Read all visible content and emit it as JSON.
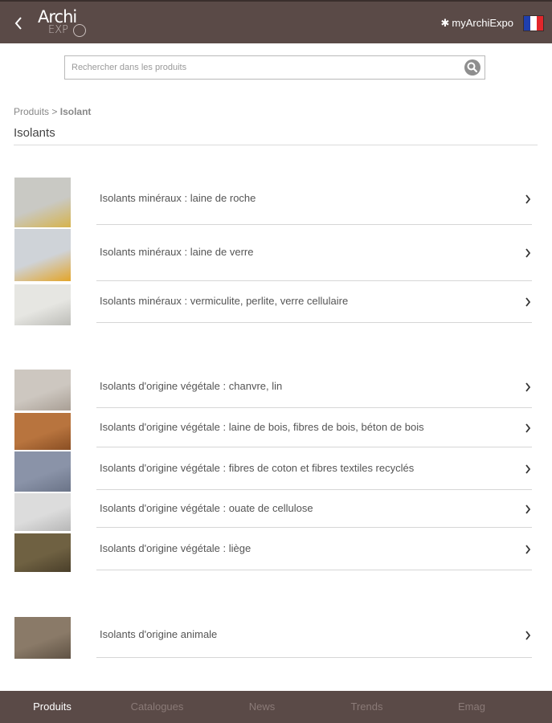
{
  "header": {
    "logo_top": "Archi",
    "logo_bottom": "EXP",
    "my_expo_label": "myArchiExpo",
    "flag_colors": [
      "#1f3fae",
      "#ffffff",
      "#e1262b"
    ]
  },
  "search": {
    "placeholder": "Rechercher dans les produits",
    "value": ""
  },
  "breadcrumb": {
    "root": "Produits",
    "separator": ">",
    "current": "Isolant"
  },
  "page_title": "Isolants",
  "groups": [
    {
      "items": [
        {
          "label": "Isolants minéraux : laine de roche",
          "thumb": "rock-wool-thumbnail",
          "colors": [
            "#c9c9c4",
            "#d6b34c"
          ]
        },
        {
          "label": "Isolants minéraux : laine de verre",
          "thumb": "glass-wool-thumbnail",
          "colors": [
            "#cfd3d8",
            "#e3a52a"
          ]
        },
        {
          "label": "Isolants minéraux : vermiculite, perlite, verre cellulaire",
          "thumb": "vermiculite-thumbnail",
          "colors": [
            "#e6e6e2",
            "#bdbdb8"
          ]
        }
      ]
    },
    {
      "items": [
        {
          "label": "Isolants d'origine végétale : chanvre, lin",
          "thumb": "hemp-thumbnail",
          "colors": [
            "#cdc7c0",
            "#a99f95"
          ]
        },
        {
          "label": "Isolants d'origine végétale : laine de bois, fibres de bois, béton de bois",
          "thumb": "wood-fiber-thumbnail",
          "colors": [
            "#b8743e",
            "#8a4f24"
          ]
        },
        {
          "label": "Isolants d'origine végétale : fibres de coton et fibres textiles recyclés",
          "thumb": "cotton-fiber-thumbnail",
          "colors": [
            "#8a93a8",
            "#6b7488"
          ]
        },
        {
          "label": "Isolants d'origine végétale : ouate de cellulose",
          "thumb": "cellulose-thumbnail",
          "colors": [
            "#dcdcdc",
            "#b7b7b7"
          ]
        },
        {
          "label": "Isolants d'origine végétale : liège",
          "thumb": "cork-thumbnail",
          "colors": [
            "#6f6142",
            "#4a3f2a"
          ]
        }
      ]
    },
    {
      "items": [
        {
          "label": "Isolants d'origine animale",
          "thumb": "sheep-wool-roll-thumbnail",
          "colors": [
            "#8a7a68",
            "#5f5244"
          ]
        }
      ]
    }
  ],
  "tabs": [
    {
      "label": "Produits",
      "active": true
    },
    {
      "label": "Catalogues",
      "active": false
    },
    {
      "label": "News",
      "active": false
    },
    {
      "label": "Trends",
      "active": false
    },
    {
      "label": "Emag",
      "active": false
    }
  ]
}
